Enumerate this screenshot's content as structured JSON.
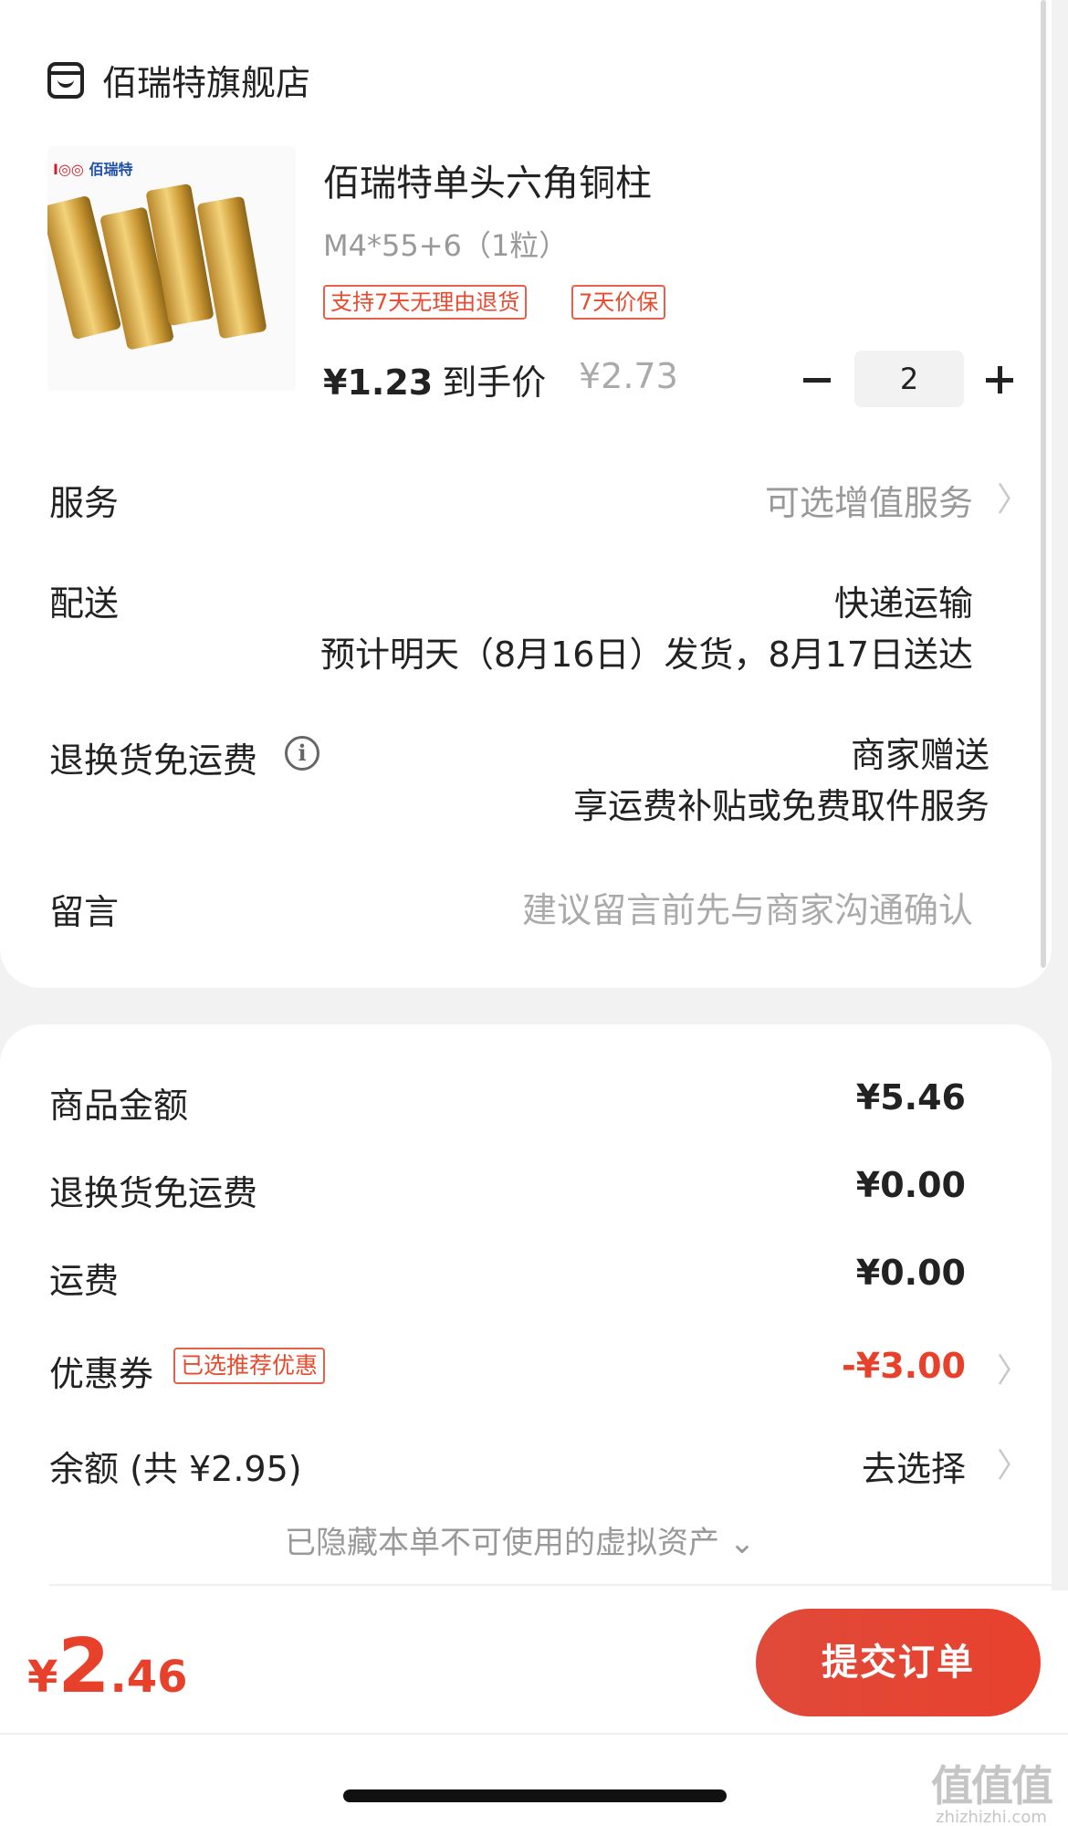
{
  "shop": {
    "name": "佰瑞特旗舰店",
    "icon": "shop-icon"
  },
  "product": {
    "brand_logo": "佰瑞特",
    "title": "佰瑞特单头六角铜柱",
    "spec": "M4*55+6（1粒）",
    "tags": [
      "支持7天无理由退货",
      "7天价保"
    ],
    "price": "¥1.23",
    "price_label": "到手价",
    "original_price": "¥2.73",
    "quantity": "2"
  },
  "rows": {
    "service": {
      "label": "服务",
      "value": "可选增值服务"
    },
    "delivery": {
      "label": "配送",
      "method": "快递运输",
      "eta": "预计明天（8月16日）发货，8月17日送达"
    },
    "return_shipping": {
      "label": "退换货免运费",
      "value": "商家赠送",
      "desc": "享运费补贴或免费取件服务"
    },
    "message": {
      "label": "留言",
      "placeholder": "建议留言前先与商家沟通确认"
    }
  },
  "summary": {
    "goods_amount": {
      "label": "商品金额",
      "value": "¥5.46"
    },
    "return_fee": {
      "label": "退换货免运费",
      "value": "¥0.00"
    },
    "shipping": {
      "label": "运费",
      "value": "¥0.00"
    },
    "coupon": {
      "label": "优惠券",
      "tag": "已选推荐优惠",
      "value": "-¥3.00"
    },
    "balance": {
      "label": "余额 (共 ¥2.95)",
      "value": "去选择"
    },
    "hidden_assets": "已隐藏本单不可使用的虚拟资产 ⌄"
  },
  "footer": {
    "total_symbol": "¥",
    "total_int": "2",
    "total_dec": ".46",
    "submit_label": "提交订单"
  },
  "watermark": {
    "line1": "值值值",
    "line2": "zhizhizhi.com"
  },
  "colors": {
    "accent": "#e8412b",
    "muted": "#999999"
  }
}
